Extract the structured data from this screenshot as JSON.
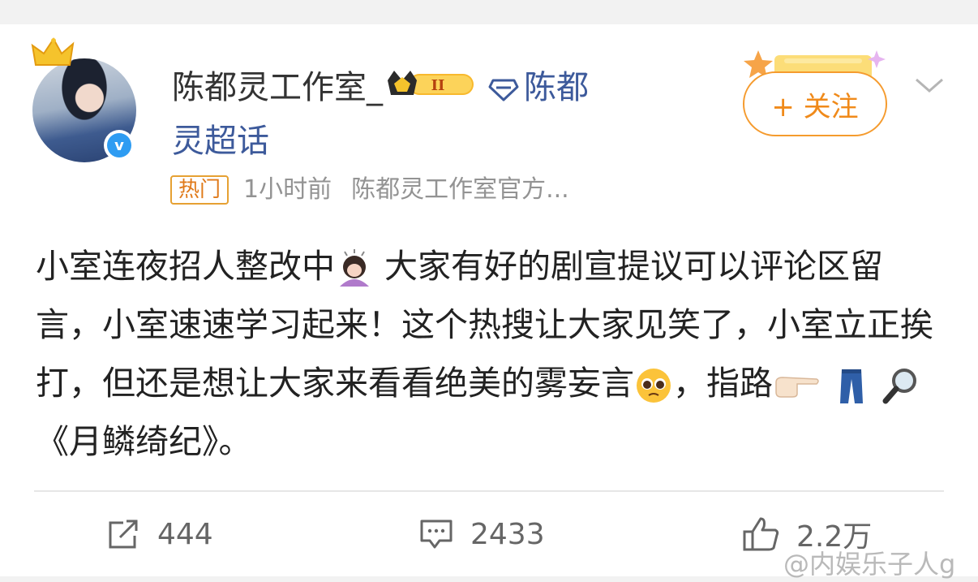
{
  "post": {
    "author": "陈都灵工作室_",
    "level_badge": "II",
    "topic_line1": "陈都",
    "topic_line2": "灵超话",
    "hot_tag": "热门",
    "time": "1小时前",
    "source": "陈都灵工作室官方...",
    "follow_label": "+ 关注",
    "content": {
      "seg1": "小室连夜招人整改中",
      "seg2": " 大家有好的剧宣提议可以评论区留言，小室速速学习起来！这个热搜让大家见笑了，小室立正挨打，但还是想让大家来看看绝美的雾妄言",
      "seg3": "，指路",
      "seg4": "《月鳞绮纪》。"
    }
  },
  "actions": {
    "repost_count": "444",
    "comment_count": "2433",
    "like_count": "2.2万"
  },
  "watermark": "@内娱乐子人g",
  "colors": {
    "accent": "#f08a1a",
    "link": "#3d5a9b",
    "verified": "#2e9cf2"
  },
  "icons": {
    "repost": "share-square-icon",
    "comment": "comment-bubble-icon",
    "like": "thumbs-up-icon"
  }
}
